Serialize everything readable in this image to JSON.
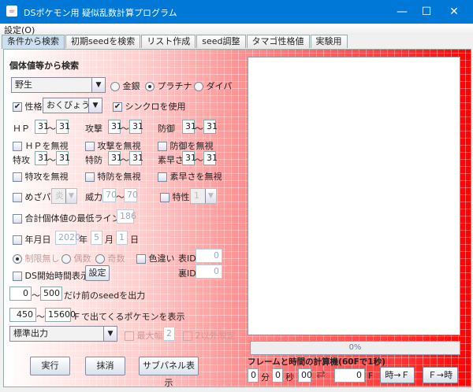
{
  "window": {
    "title": "DSポケモン用 疑似乱数計算プログラム",
    "minimize": "—",
    "maximize": "☐",
    "close": "✕"
  },
  "menu": {
    "settings": "設定(O)"
  },
  "tabs": [
    "条件から検索",
    "初期seedを検索",
    "リスト作成",
    "seed調整",
    "タマゴ性格値",
    "実験用"
  ],
  "form": {
    "heading": "個体値等から検索",
    "encounter": "野生",
    "versions": [
      "金銀",
      "プラチナ",
      "ダイパ"
    ],
    "selected_version": "プラチナ",
    "nature_label": "性格",
    "nature_checked": true,
    "nature": "おくびょう",
    "synchro_label": "シンクロを使用",
    "synchro_checked": true,
    "stats": [
      {
        "label": "ＨＰ",
        "min": "31",
        "max": "31",
        "ignore": "ＨＰを無視"
      },
      {
        "label": "攻撃",
        "min": "31",
        "max": "31",
        "ignore": "攻撃を無視"
      },
      {
        "label": "防御",
        "min": "31",
        "max": "31",
        "ignore": "防御を無視"
      },
      {
        "label": "特攻",
        "min": "31",
        "max": "31",
        "ignore": "特攻を無視"
      },
      {
        "label": "特防",
        "min": "31",
        "max": "31",
        "ignore": "特防を無視"
      },
      {
        "label": "素早さ",
        "min": "31",
        "max": "31",
        "ignore": "素早さを無視"
      }
    ],
    "tilde": "〜",
    "hp_label": "めざパ",
    "hp_type": "炎",
    "power_label": "威力",
    "power_min": "70",
    "power_max": "70",
    "ability_label": "特性",
    "ability": "1",
    "total_label": "合計個体値の最低ライン",
    "total": "186",
    "date_label": "年月日",
    "year": "2020",
    "year_unit": "年",
    "month": "5",
    "month_unit": "月",
    "day": "1",
    "day_unit": "日",
    "parity": [
      "制限無し",
      "偶数",
      "奇数"
    ],
    "shiny_label": "色違い",
    "tid_label": "表ID",
    "tid": "0",
    "sid_label": "裏ID",
    "sid": "0",
    "ds_time_label": "DS開始時間表示",
    "ds_time_button": "設定",
    "seed_min": "0",
    "seed_max": "500",
    "seed_suffix": "だけ前のseedを出力",
    "frame_min": "450",
    "frame_max": "15600",
    "frame_suffix": "Ｆで出てくるポケモンを表示",
    "output_mode": "標準出力",
    "max_width_label": "最大幅",
    "max_width": "2",
    "limit_label": "2以外限定",
    "run": "実行",
    "clear": "抹消",
    "subpanel": "サブパネル表示"
  },
  "right": {
    "progress": "0%",
    "progress_value": 0,
    "calc_title": "フレームと時間の計算機(60Fで1秒)",
    "min": "0",
    "min_unit": "分",
    "sec": "0",
    "sec_unit": "秒",
    "frac": "00",
    "swap": "⇄",
    "frame": "0",
    "frame_unit": "F",
    "to_frame": "時→Ｆ",
    "to_time": "Ｆ→時"
  }
}
